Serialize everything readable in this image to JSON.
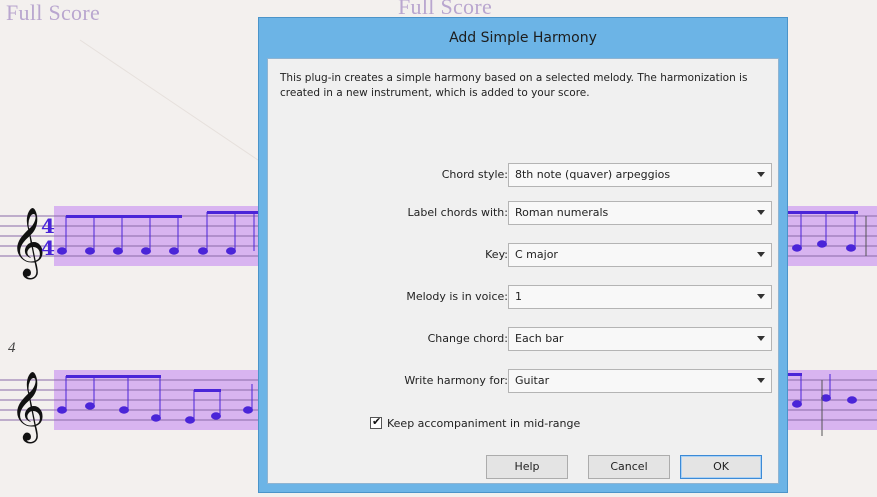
{
  "score": {
    "title_left": "Full Score",
    "title_center": "Full Score",
    "measure_number": "4",
    "time_signature_top": "4",
    "time_signature_bottom": "4",
    "staff_color": "#d8b4f0",
    "note_color": "#4a25d8"
  },
  "dialog": {
    "title": "Add Simple Harmony",
    "description": "This plug-in creates a simple harmony based on a selected melody. The harmonization is created in a new instrument, which is added to your score.",
    "fields": [
      {
        "label": "Chord style:",
        "value": "8th note (quaver) arpeggios"
      },
      {
        "label": "Label chords with:",
        "value": "Roman numerals"
      },
      {
        "label": "Key:",
        "value": "C major"
      },
      {
        "label": "Melody is in voice:",
        "value": "1"
      },
      {
        "label": "Change chord:",
        "value": "Each bar"
      },
      {
        "label": "Write harmony for:",
        "value": "Guitar"
      }
    ],
    "checkbox": {
      "label": "Keep accompaniment in mid-range",
      "checked": true,
      "mark": "✔"
    },
    "buttons": {
      "help": "Help",
      "cancel": "Cancel",
      "ok": "OK"
    },
    "accent_color": "#6cb4e6"
  }
}
